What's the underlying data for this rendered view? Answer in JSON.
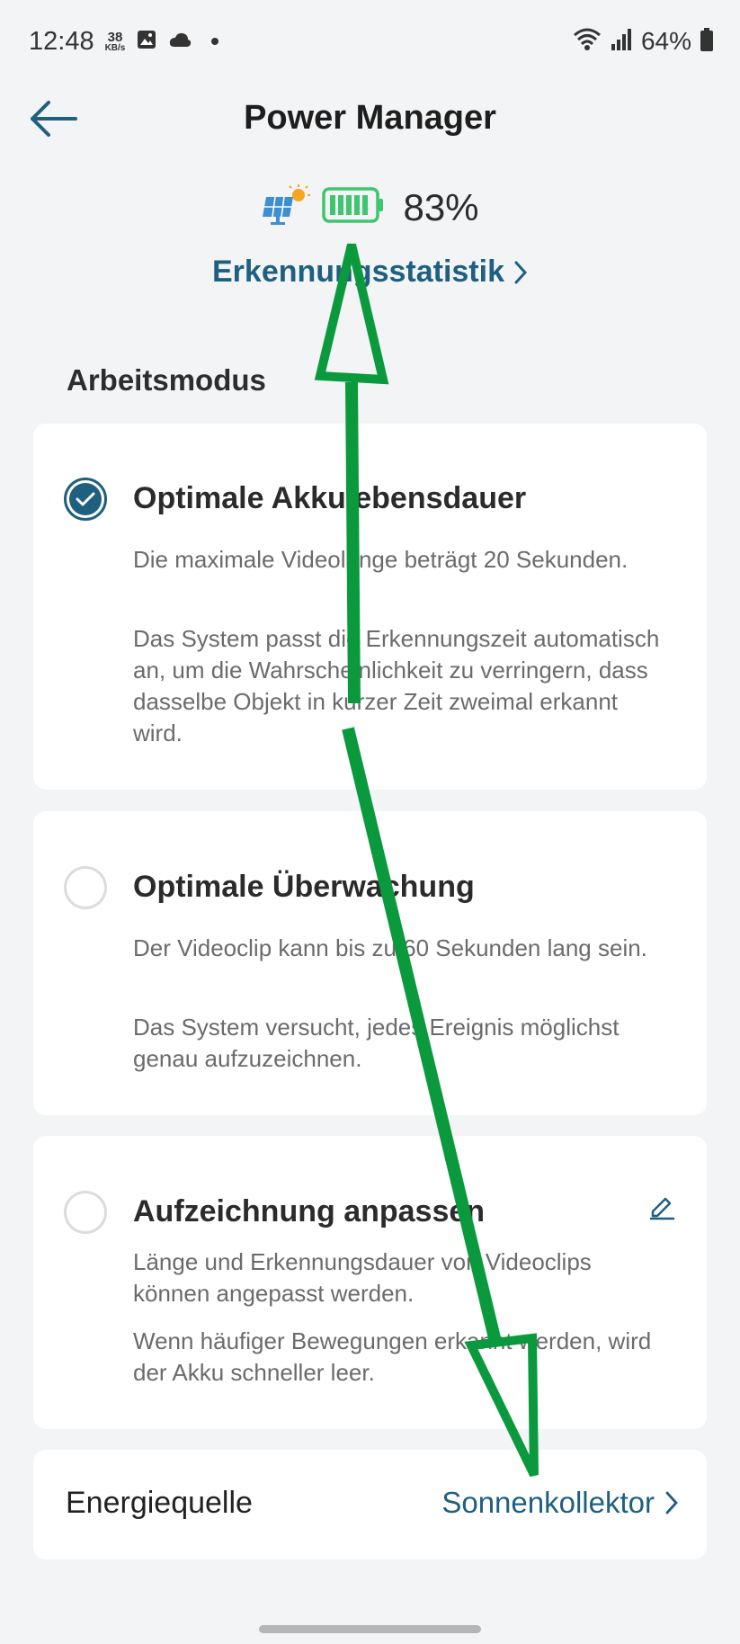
{
  "status_bar": {
    "time": "12:48",
    "net_speed_value": "38",
    "net_speed_unit": "KB/s",
    "battery_percent": "64%"
  },
  "header": {
    "title": "Power Manager"
  },
  "power": {
    "battery_level": "83%",
    "stats_link_label": "Erkennungsstatistik"
  },
  "work_mode": {
    "section_title": "Arbeitsmodus",
    "modes": [
      {
        "title": "Optimale Akkulebensdauer",
        "line1": "Die maximale Videolänge beträgt 20 Sekunden.",
        "line2": "Das System passt die Erkennungszeit automatisch an, um die Wahrscheinlichkeit zu verringern, dass dasselbe Objekt in kurzer Zeit zweimal erkannt wird.",
        "selected": true
      },
      {
        "title": "Optimale Überwachung",
        "line1": "Der Videoclip kann bis zu 60 Sekunden lang sein.",
        "line2": "Das System versucht, jedes Ereignis möglichst genau aufzuzeichnen.",
        "selected": false
      },
      {
        "title": "Aufzeichnung anpassen",
        "line1": "Länge und Erkennungsdauer von Videoclips können angepasst werden.",
        "line2": "Wenn häufiger Bewegungen erkannt werden, wird der Akku schneller leer.",
        "selected": false
      }
    ]
  },
  "energy_source": {
    "label": "Energiequelle",
    "value": "Sonnenkollektor"
  },
  "colors": {
    "accent": "#1f5f80",
    "battery_green": "#3fc56e",
    "annotation_green": "#0a9a3d"
  }
}
